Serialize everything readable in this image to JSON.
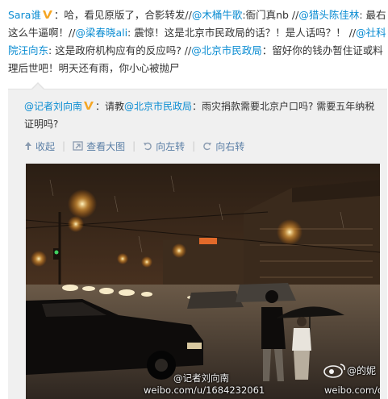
{
  "post": {
    "author": "Sara谁",
    "text_1": "：哈，看见原版了，合影转发//",
    "mention_1": "@木桶牛歌",
    "text_2": ":衙门真nb //",
    "mention_2": "@猎头陈佳林",
    "text_3": ": 最右这么牛逼啊！//",
    "mention_3": "@梁春晓ali",
    "text_4": ": 震惊！这是北京市民政局的话？！是人话吗？！ //",
    "mention_4": "@社科院汪向东",
    "text_5": ": 这是政府机构应有的反应吗? //",
    "mention_5": "@北京市民政局",
    "text_6": "：留好你的钱办暂住证或料理后世吧！明天还有雨，你小心被抛尸"
  },
  "repost": {
    "author": "@记者刘向南",
    "text_1": "：请教",
    "mention": "@北京市民政局",
    "text_2": "：雨灾捐款需要北京户口吗? 需要五年纳税证明吗?"
  },
  "actions": {
    "collapse": "收起",
    "view_large": "查看大图",
    "rotate_left": "向左转",
    "rotate_right": "向右转"
  },
  "photo": {
    "watermark_author": "@记者刘向南",
    "watermark_url": "weibo.com/u/1684232061",
    "watermark_handle": "@的妮",
    "watermark_url_2": "weibo.com/den"
  },
  "colors": {
    "link": "#0a8cd2",
    "verified_badge": "#f5a623",
    "action_text": "#5b7fa6"
  }
}
